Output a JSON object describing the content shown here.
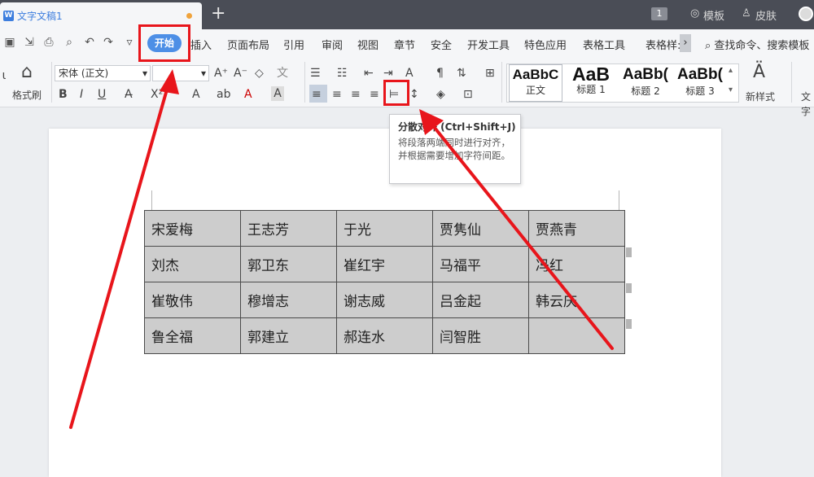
{
  "titlebar": {
    "doc_tab_icon": "W",
    "doc_tab_title": "文字文稿1",
    "new_tab": "+",
    "window_badge": "1",
    "template_label": "模板",
    "skin_label": "皮肤"
  },
  "menubar": {
    "tabs": [
      "开始",
      "插入",
      "页面布局",
      "引用",
      "审阅",
      "视图",
      "章节",
      "安全",
      "开发工具",
      "特色应用",
      "表格工具",
      "表格样:"
    ],
    "search_label": "查找命令、搜索模板",
    "more_glyph": "›"
  },
  "ribbon": {
    "format_painter_label": "格式刷",
    "font_name": "宋体 (正文)",
    "font_size": "",
    "bold": "B",
    "italic": "I",
    "underline": "U",
    "styles": [
      {
        "sample": "AaBbC",
        "name": "正文"
      },
      {
        "sample": "AaB",
        "name": "标题 1"
      },
      {
        "sample": "AaBb(",
        "name": "标题 2"
      },
      {
        "sample": "AaBb(",
        "name": "标题 3"
      }
    ],
    "new_style_label": "新样式",
    "text_tools_label": "文字"
  },
  "tooltip": {
    "title": "分散对齐 (Ctrl+Shift+J)",
    "description": "将段落两端同时进行对齐，并根据需要增加字符间距。"
  },
  "table": {
    "rows": [
      [
        "宋爱梅",
        "王志芳",
        "于光",
        "贾隽仙",
        "贾燕青"
      ],
      [
        "刘杰",
        "郭卫东",
        "崔红宇",
        "马福平",
        "冯红"
      ],
      [
        "崔敬伟",
        "穆增志",
        "谢志威",
        "吕金起",
        "韩云庆"
      ],
      [
        "鲁全福",
        "郭建立",
        "郝连水",
        "闫智胜",
        ""
      ]
    ]
  },
  "annotation_color": "#e8151b",
  "accent_color": "#4d8fe6"
}
